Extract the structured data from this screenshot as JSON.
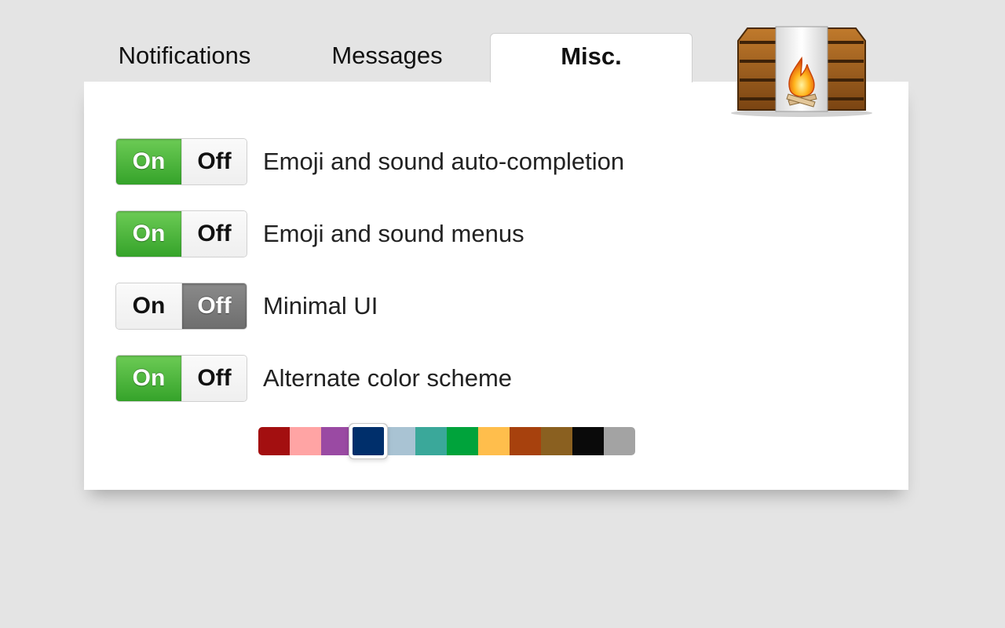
{
  "tabs": [
    {
      "label": "Notifications",
      "active": false
    },
    {
      "label": "Messages",
      "active": false
    },
    {
      "label": "Misc.",
      "active": true
    }
  ],
  "logo_icon": "campfire-logo",
  "settings": [
    {
      "label": "Emoji and sound auto-completion",
      "on_label": "On",
      "off_label": "Off",
      "value": "On"
    },
    {
      "label": "Emoji and sound menus",
      "on_label": "On",
      "off_label": "Off",
      "value": "On"
    },
    {
      "label": "Minimal UI",
      "on_label": "On",
      "off_label": "Off",
      "value": "Off"
    },
    {
      "label": "Alternate color scheme",
      "on_label": "On",
      "off_label": "Off",
      "value": "On"
    }
  ],
  "color_scheme": {
    "selected": "#002f6b",
    "swatches": [
      "#a30f10",
      "#ffa4a4",
      "#9a4aa3",
      "#002f6b",
      "#a9c3d3",
      "#3aa89a",
      "#00a33b",
      "#ffbe4c",
      "#a7410d",
      "#8a6020",
      "#0a0a0a",
      "#a3a3a3"
    ]
  },
  "colors": {
    "on_active": "#3faa31",
    "off_active": "#7a7a7a",
    "background": "#e4e4e4",
    "panel": "#ffffff"
  }
}
